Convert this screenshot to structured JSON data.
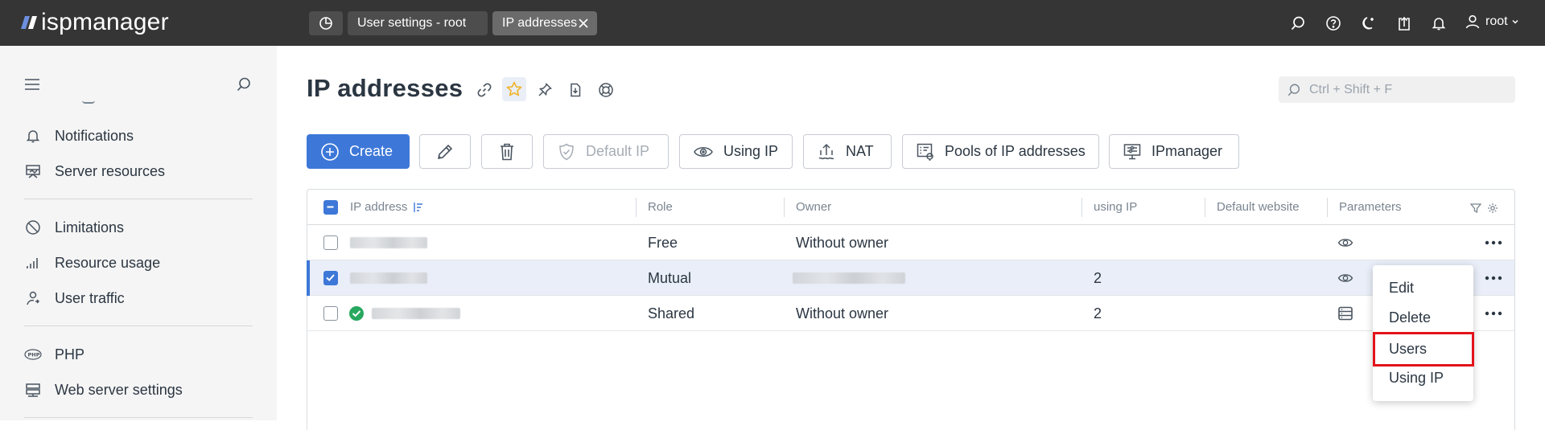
{
  "app": {
    "logo_text": "ispmanager"
  },
  "topbar": {
    "tabs": [
      {
        "label": "User settings - root"
      },
      {
        "label": "IP addresses"
      }
    ],
    "user": "root"
  },
  "sidebar": {
    "items": [
      {
        "label": "Notifications",
        "icon": "bell-icon"
      },
      {
        "label": "Server resources",
        "icon": "server-resources-icon"
      },
      {
        "label": "Limitations",
        "icon": "ban-icon"
      },
      {
        "label": "Resource usage",
        "icon": "bar-chart-icon"
      },
      {
        "label": "User traffic",
        "icon": "user-traffic-icon"
      },
      {
        "label": "PHP",
        "icon": "php-icon"
      },
      {
        "label": "Web server settings",
        "icon": "web-server-icon"
      }
    ]
  },
  "page": {
    "title": "IP addresses",
    "search_placeholder": "Ctrl + Shift + F"
  },
  "toolbar": {
    "create": "Create",
    "default_ip": "Default IP",
    "using_ip": "Using IP",
    "nat": "NAT",
    "pools": "Pools of IP addresses",
    "ipmanager": "IPmanager"
  },
  "table": {
    "columns": [
      "IP address",
      "Role",
      "Owner",
      "using IP",
      "Default website",
      "Parameters"
    ],
    "rows": [
      {
        "role": "Free",
        "owner": "Without owner",
        "using_ip": "",
        "selected": false
      },
      {
        "role": "Mutual",
        "owner": "",
        "using_ip": "2",
        "selected": true
      },
      {
        "role": "Shared",
        "owner": "Without owner",
        "using_ip": "2",
        "selected": false
      }
    ]
  },
  "context_menu": {
    "items": [
      "Edit",
      "Delete",
      "Users",
      "Using IP"
    ],
    "highlighted": "Users"
  },
  "colors": {
    "accent": "#3d78d8",
    "topbar": "#353535",
    "highlight": "#e3131b",
    "star": "#f0b429",
    "ok": "#27a85f"
  }
}
